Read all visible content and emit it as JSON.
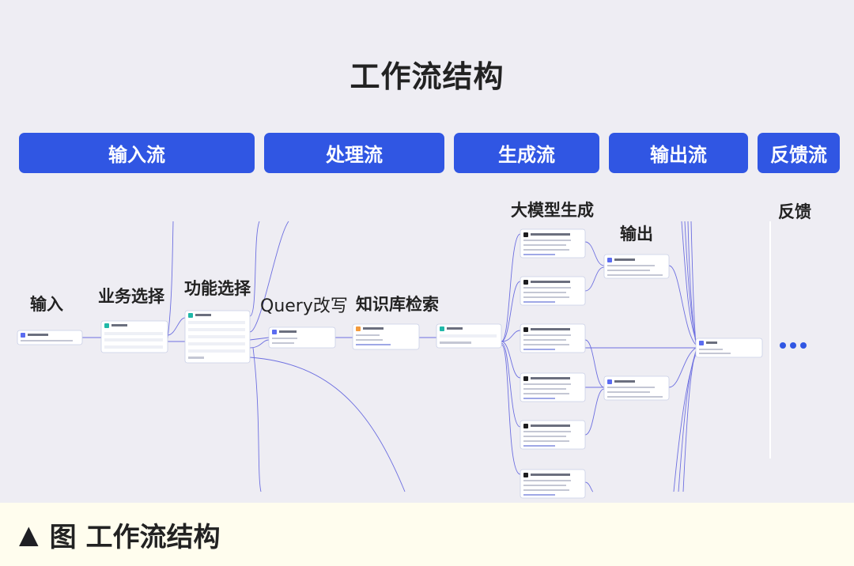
{
  "title": "工作流结构",
  "stages": [
    "输入流",
    "处理流",
    "生成流",
    "输出流",
    "反馈流"
  ],
  "labels": {
    "input": "输入",
    "business": "业务选择",
    "function": "功能选择",
    "query": "Query改写",
    "kb": "知识库检索",
    "llm": "大模型生成",
    "output": "输出",
    "feedback": "反馈"
  },
  "caption": {
    "marker": "▲",
    "text": "图  工作流结构"
  },
  "colors": {
    "stage": "#3056e3",
    "background": "#eeedf3",
    "footer": "#fffdee",
    "line": "#6d6fe0"
  }
}
